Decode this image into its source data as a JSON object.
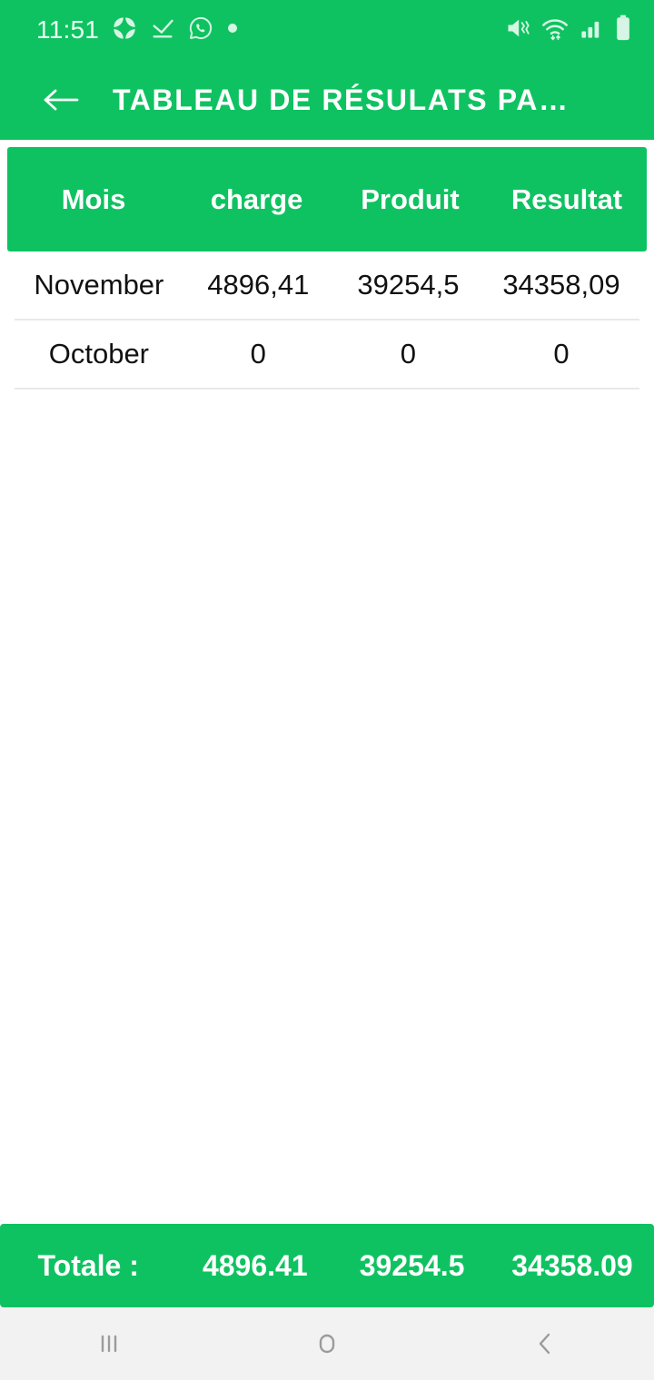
{
  "status_bar": {
    "clock": "11:51",
    "left_icons": [
      {
        "name": "app-flower-icon"
      },
      {
        "name": "download-complete-icon"
      },
      {
        "name": "whatsapp-icon"
      },
      {
        "name": "dot-indicator-icon"
      }
    ],
    "right_icons": [
      {
        "name": "mute-vibrate-icon"
      },
      {
        "name": "wifi-icon"
      },
      {
        "name": "signal-bars-icon"
      },
      {
        "name": "battery-icon"
      }
    ]
  },
  "app_bar": {
    "back_icon": "back-arrow-icon",
    "title": "TABLEAU DE RÉSULATS PA…"
  },
  "table": {
    "columns": [
      "Mois",
      "charge",
      "Produit",
      "Resultat"
    ],
    "rows": [
      {
        "mois": "November",
        "charge": "4896,41",
        "produit": "39254,5",
        "resultat": "34358,09"
      },
      {
        "mois": "October",
        "charge": "0",
        "produit": "0",
        "resultat": "0"
      }
    ]
  },
  "total_bar": {
    "label": "Totale :",
    "charge": "4896.41",
    "produit": "39254.5",
    "resultat": "34358.09"
  },
  "nav_bar": {
    "recents": "recents-icon",
    "home": "home-icon",
    "back": "back-icon"
  },
  "colors": {
    "brand_green": "#0FC261",
    "nav_background": "#f2f2f2",
    "row_divider": "#e9e9e9",
    "text_dark": "#111111"
  }
}
